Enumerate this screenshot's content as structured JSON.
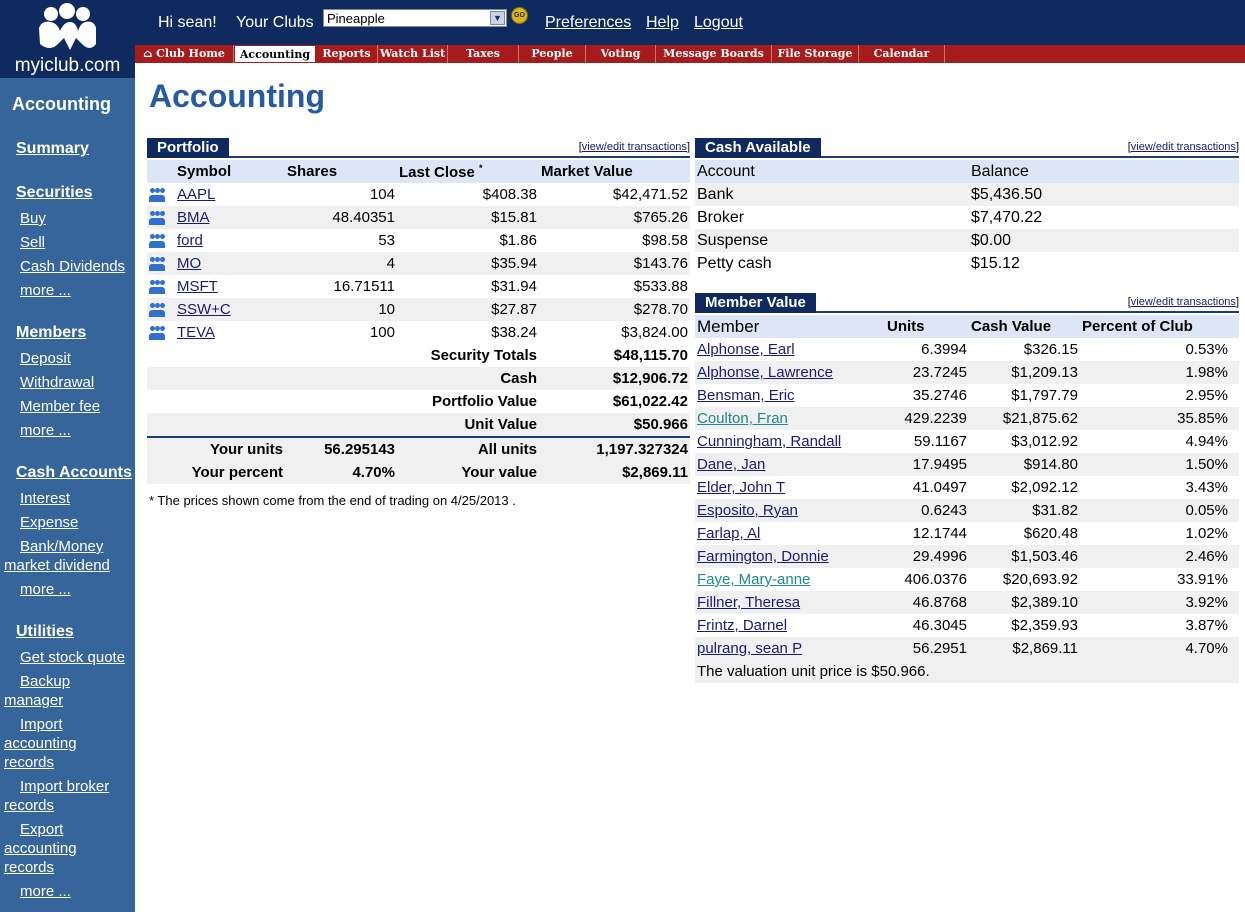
{
  "header": {
    "logo_text": "myiclub.com",
    "greeting": "Hi sean!",
    "your_clubs_label": "Your Clubs",
    "club_selected": "Pineapple",
    "go_label": "GO",
    "links": [
      "Preferences",
      "Help",
      "Logout"
    ]
  },
  "tabs": [
    "Club Home",
    "Accounting",
    "Reports",
    "Watch List",
    "Taxes",
    "People",
    "Voting",
    "Message Boards",
    "File Storage",
    "Calendar"
  ],
  "active_tab": "Accounting",
  "sidebar": {
    "title": "Accounting",
    "summary": "Summary",
    "securities": {
      "label": "Securities",
      "items": [
        "Buy",
        "Sell",
        "Cash Dividends",
        "more ..."
      ]
    },
    "members": {
      "label": "Members",
      "items": [
        "Deposit",
        "Withdrawal",
        "Member fee",
        "more ..."
      ]
    },
    "cash_accounts": {
      "label": "Cash Accounts",
      "items": [
        "Interest",
        "Expense",
        "Bank/Money market dividend",
        "more ..."
      ]
    },
    "utilities": {
      "label": "Utilities",
      "items": [
        "Get stock quote",
        "Backup manager",
        "Import accounting records",
        "Import broker records",
        "Export accounting records",
        "more ..."
      ]
    }
  },
  "page_title": "Accounting",
  "portfolio": {
    "title": "Portfolio",
    "edit_link": "view/edit transactions",
    "columns": [
      "Symbol",
      "Shares",
      "Last Close",
      "Market Value"
    ],
    "asterisk": "*",
    "rows": [
      {
        "symbol": "AAPL",
        "shares": "104",
        "last_close": "$408.38",
        "market_value": "$42,471.52"
      },
      {
        "symbol": "BMA",
        "shares": "48.40351",
        "last_close": "$15.81",
        "market_value": "$765.26"
      },
      {
        "symbol": "ford",
        "shares": "53",
        "last_close": "$1.86",
        "market_value": "$98.58"
      },
      {
        "symbol": "MO",
        "shares": "4",
        "last_close": "$35.94",
        "market_value": "$143.76"
      },
      {
        "symbol": "MSFT",
        "shares": "16.71511",
        "last_close": "$31.94",
        "market_value": "$533.88"
      },
      {
        "symbol": "SSW+C",
        "shares": "10",
        "last_close": "$27.87",
        "market_value": "$278.70"
      },
      {
        "symbol": "TEVA",
        "shares": "100",
        "last_close": "$38.24",
        "market_value": "$3,824.00"
      }
    ],
    "totals": [
      {
        "label": "Security Totals",
        "value": "$48,115.70"
      },
      {
        "label": "Cash",
        "value": "$12,906.72"
      },
      {
        "label": "Portfolio Value",
        "value": "$61,022.42"
      },
      {
        "label": "Unit Value",
        "value": "$50.966"
      }
    ],
    "your_units_label": "Your units",
    "your_units": "56.295143",
    "all_units_label": "All units",
    "all_units": "1,197.327324",
    "your_percent_label": "Your percent",
    "your_percent": "4.70%",
    "your_value_label": "Your value",
    "your_value": "$2,869.11",
    "footnote": "* The prices shown come from the end of trading on 4/25/2013 ."
  },
  "cash_available": {
    "title": "Cash Available",
    "edit_link": "view/edit transactions",
    "columns": [
      "Account",
      "Balance"
    ],
    "rows": [
      {
        "account": "Bank",
        "balance": "$5,436.50"
      },
      {
        "account": "Broker",
        "balance": "$7,470.22"
      },
      {
        "account": "Suspense",
        "balance": "$0.00"
      },
      {
        "account": "Petty cash",
        "balance": "$15.12"
      }
    ]
  },
  "member_value": {
    "title": "Member Value",
    "edit_link": "view/edit transactions",
    "columns": [
      "Member",
      "Units",
      "Cash Value",
      "Percent of Club"
    ],
    "rows": [
      {
        "member": "Alphonse, Earl",
        "units": "6.3994",
        "cash": "$326.15",
        "pct": "0.53%"
      },
      {
        "member": "Alphonse, Lawrence",
        "units": "23.7245",
        "cash": "$1,209.13",
        "pct": "1.98%"
      },
      {
        "member": "Bensman, Eric",
        "units": "35.2746",
        "cash": "$1,797.79",
        "pct": "2.95%"
      },
      {
        "member": "Coulton, Fran",
        "units": "429.2239",
        "cash": "$21,875.62",
        "pct": "35.85%"
      },
      {
        "member": "Cunningham, Randall",
        "units": "59.1167",
        "cash": "$3,012.92",
        "pct": "4.94%"
      },
      {
        "member": "Dane, Jan",
        "units": "17.9495",
        "cash": "$914.80",
        "pct": "1.50%"
      },
      {
        "member": "Elder, John T",
        "units": "41.0497",
        "cash": "$2,092.12",
        "pct": "3.43%"
      },
      {
        "member": "Esposito, Ryan",
        "units": "0.6243",
        "cash": "$31.82",
        "pct": "0.05%"
      },
      {
        "member": "Farlap, Al",
        "units": "12.1744",
        "cash": "$620.48",
        "pct": "1.02%"
      },
      {
        "member": "Farmington, Donnie",
        "units": "29.4996",
        "cash": "$1,503.46",
        "pct": "2.46%"
      },
      {
        "member": "Faye, Mary-anne",
        "units": "406.0376",
        "cash": "$20,693.92",
        "pct": "33.91%"
      },
      {
        "member": "Fillner, Theresa",
        "units": "46.8768",
        "cash": "$2,389.10",
        "pct": "3.92%"
      },
      {
        "member": "Frintz, Darnel",
        "units": "46.3045",
        "cash": "$2,359.93",
        "pct": "3.87%"
      },
      {
        "member": "pulrang, sean P",
        "units": "56.2951",
        "cash": "$2,869.11",
        "pct": "4.70%"
      }
    ],
    "note": "The valuation unit price is $50.966."
  }
}
